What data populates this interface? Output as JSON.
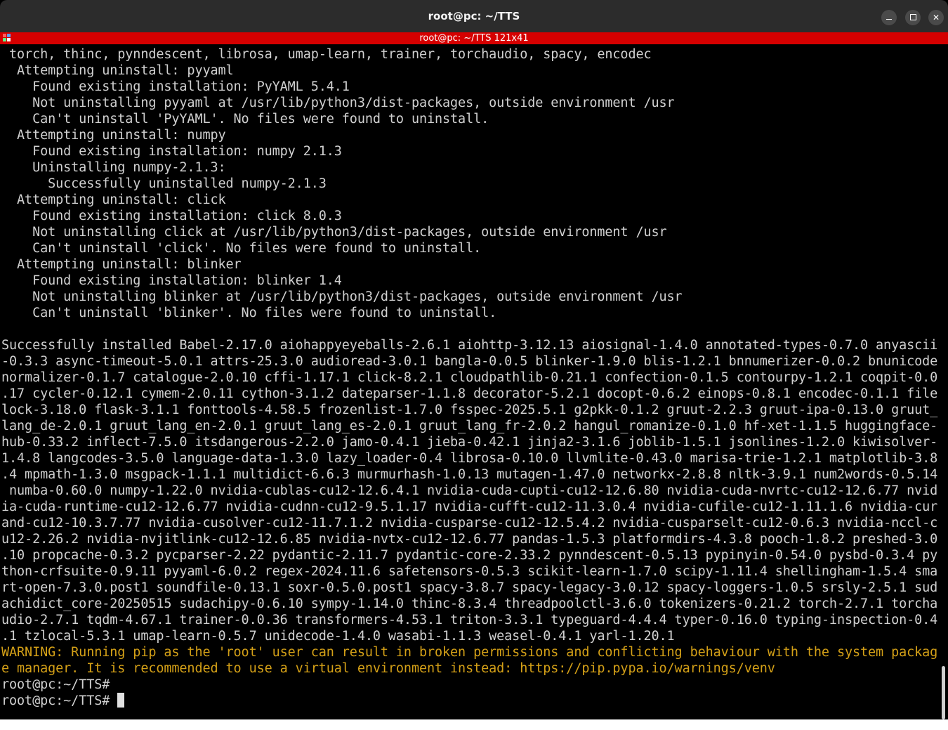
{
  "window": {
    "title": "root@pc: ~/TTS",
    "buttons": {
      "minimize": "minimize-icon",
      "maximize": "maximize-icon",
      "close": "close-icon"
    }
  },
  "tmux": {
    "title": "root@pc: ~/TTS 121x41",
    "status_color": "#d50000"
  },
  "terminal": {
    "lines": [
      " torch, thinc, pynndescent, librosa, umap-learn, trainer, torchaudio, spacy, encodec",
      "  Attempting uninstall: pyyaml",
      "    Found existing installation: PyYAML 5.4.1",
      "    Not uninstalling pyyaml at /usr/lib/python3/dist-packages, outside environment /usr",
      "    Can't uninstall 'PyYAML'. No files were found to uninstall.",
      "  Attempting uninstall: numpy",
      "    Found existing installation: numpy 2.1.3",
      "    Uninstalling numpy-2.1.3:",
      "      Successfully uninstalled numpy-2.1.3",
      "  Attempting uninstall: click",
      "    Found existing installation: click 8.0.3",
      "    Not uninstalling click at /usr/lib/python3/dist-packages, outside environment /usr",
      "    Can't uninstall 'click'. No files were found to uninstall.",
      "  Attempting uninstall: blinker",
      "    Found existing installation: blinker 1.4",
      "    Not uninstalling blinker at /usr/lib/python3/dist-packages, outside environment /usr",
      "    Can't uninstall 'blinker'. No files were found to uninstall.",
      "",
      "Successfully installed Babel-2.17.0 aiohappyeyeballs-2.6.1 aiohttp-3.12.13 aiosignal-1.4.0 annotated-types-0.7.0 anyascii",
      "-0.3.3 async-timeout-5.0.1 attrs-25.3.0 audioread-3.0.1 bangla-0.0.5 blinker-1.9.0 blis-1.2.1 bnnumerizer-0.0.2 bnunicode",
      "normalizer-0.1.7 catalogue-2.0.10 cffi-1.17.1 click-8.2.1 cloudpathlib-0.21.1 confection-0.1.5 contourpy-1.2.1 coqpit-0.0",
      ".17 cycler-0.12.1 cymem-2.0.11 cython-3.1.2 dateparser-1.1.8 decorator-5.2.1 docopt-0.6.2 einops-0.8.1 encodec-0.1.1 file",
      "lock-3.18.0 flask-3.1.1 fonttools-4.58.5 frozenlist-1.7.0 fsspec-2025.5.1 g2pkk-0.1.2 gruut-2.2.3 gruut-ipa-0.13.0 gruut_",
      "lang_de-2.0.1 gruut_lang_en-2.0.1 gruut_lang_es-2.0.1 gruut_lang_fr-2.0.2 hangul_romanize-0.1.0 hf-xet-1.1.5 huggingface-",
      "hub-0.33.2 inflect-7.5.0 itsdangerous-2.2.0 jamo-0.4.1 jieba-0.42.1 jinja2-3.1.6 joblib-1.5.1 jsonlines-1.2.0 kiwisolver-",
      "1.4.8 langcodes-3.5.0 language-data-1.3.0 lazy_loader-0.4 librosa-0.10.0 llvmlite-0.43.0 marisa-trie-1.2.1 matplotlib-3.8",
      ".4 mpmath-1.3.0 msgpack-1.1.1 multidict-6.6.3 murmurhash-1.0.13 mutagen-1.47.0 networkx-2.8.8 nltk-3.9.1 num2words-0.5.14",
      " numba-0.60.0 numpy-1.22.0 nvidia-cublas-cu12-12.6.4.1 nvidia-cuda-cupti-cu12-12.6.80 nvidia-cuda-nvrtc-cu12-12.6.77 nvid",
      "ia-cuda-runtime-cu12-12.6.77 nvidia-cudnn-cu12-9.5.1.17 nvidia-cufft-cu12-11.3.0.4 nvidia-cufile-cu12-1.11.1.6 nvidia-cur",
      "and-cu12-10.3.7.77 nvidia-cusolver-cu12-11.7.1.2 nvidia-cusparse-cu12-12.5.4.2 nvidia-cusparselt-cu12-0.6.3 nvidia-nccl-c",
      "u12-2.26.2 nvidia-nvjitlink-cu12-12.6.85 nvidia-nvtx-cu12-12.6.77 pandas-1.5.3 platformdirs-4.3.8 pooch-1.8.2 preshed-3.0",
      ".10 propcache-0.3.2 pycparser-2.22 pydantic-2.11.7 pydantic-core-2.33.2 pynndescent-0.5.13 pypinyin-0.54.0 pysbd-0.3.4 py",
      "thon-crfsuite-0.9.11 pyyaml-6.0.2 regex-2024.11.6 safetensors-0.5.3 scikit-learn-1.7.0 scipy-1.11.4 shellingham-1.5.4 sma",
      "rt-open-7.3.0.post1 soundfile-0.13.1 soxr-0.5.0.post1 spacy-3.8.7 spacy-legacy-3.0.12 spacy-loggers-1.0.5 srsly-2.5.1 sud",
      "achidict_core-20250515 sudachipy-0.6.10 sympy-1.14.0 thinc-8.3.4 threadpoolctl-3.6.0 tokenizers-0.21.2 torch-2.7.1 torcha",
      "udio-2.7.1 tqdm-4.67.1 trainer-0.0.36 transformers-4.53.1 triton-3.3.1 typeguard-4.4.4 typer-0.16.0 typing-inspection-0.4",
      ".1 tzlocal-5.3.1 umap-learn-0.5.7 unidecode-1.4.0 wasabi-1.1.3 weasel-0.4.1 yarl-1.20.1"
    ],
    "warning_lines": [
      "WARNING: Running pip as the 'root' user can result in broken permissions and conflicting behaviour with the system packag",
      "e manager. It is recommended to use a virtual environment instead: https://pip.pypa.io/warnings/venv"
    ],
    "prompt_lines": [
      "root@pc:~/TTS# ",
      "root@pc:~/TTS# "
    ],
    "warning_color": "#d4a017"
  }
}
